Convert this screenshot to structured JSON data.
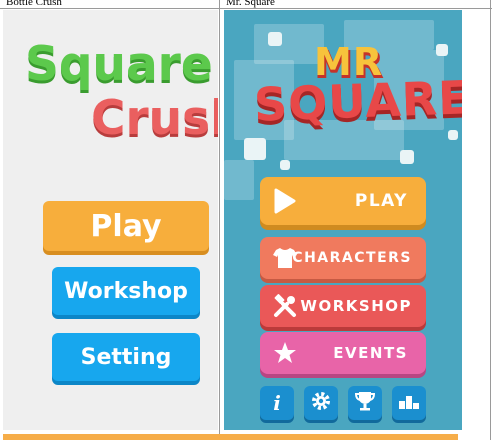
{
  "table": {
    "left_header": "Bottle Crush",
    "right_header": "Mr. Square"
  },
  "square_crush": {
    "title_line1": "Square",
    "title_line2": "Crush",
    "buttons": {
      "play": "Play",
      "workshop": "Workshop",
      "setting": "Setting"
    },
    "colors": {
      "play": "#f7ae3c",
      "secondary": "#17a7ee",
      "title_green": "#5cc94c",
      "title_red": "#ea5f5f"
    }
  },
  "mr_square": {
    "logo_line1": "MR",
    "logo_line2": "SQUARE",
    "menu": {
      "play": "PLAY",
      "characters": "CHARACTERS",
      "workshop": "WORKSHOP",
      "events": "EVENTS"
    },
    "icons": [
      "info-icon",
      "gear-icon",
      "trophy-icon",
      "leaderboard-icon"
    ],
    "colors": {
      "background": "#4aa6c0",
      "play": "#f7ae3c",
      "characters": "#f07a5e",
      "workshop": "#ea5858",
      "events": "#e864a8",
      "icon_button": "#1b8fcf"
    }
  }
}
